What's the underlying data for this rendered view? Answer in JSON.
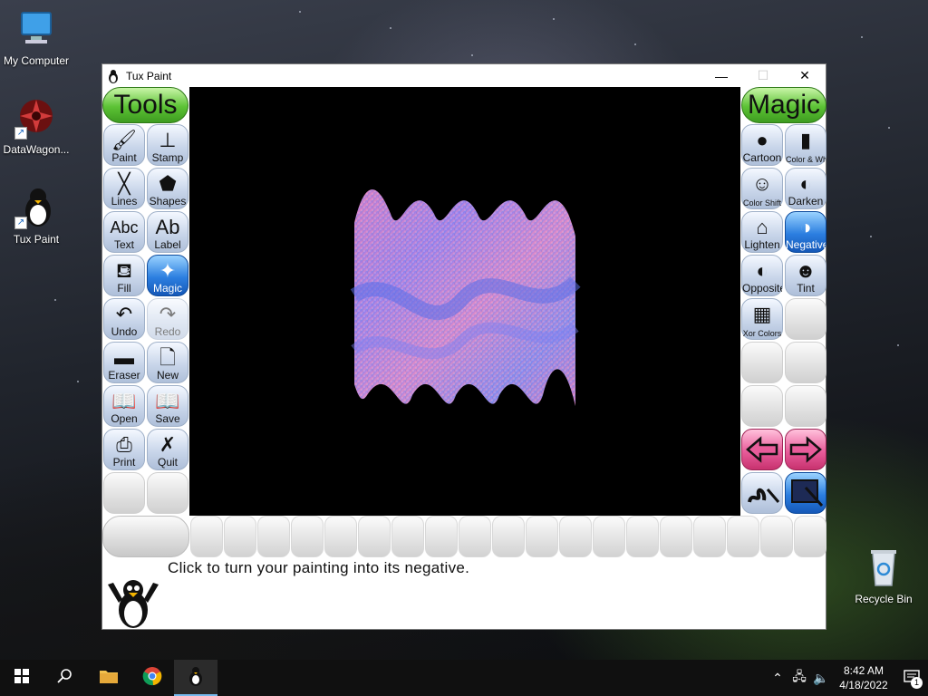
{
  "desktop": {
    "icons": [
      {
        "label": "My Computer"
      },
      {
        "label": "DataWagon..."
      },
      {
        "label": "Tux Paint"
      },
      {
        "label": "Recycle Bin"
      }
    ]
  },
  "window": {
    "title": "Tux Paint",
    "controls": {
      "minimize": "—",
      "maximize": "☐",
      "close": "✕"
    }
  },
  "tools_header": "Tools",
  "magic_header": "Magic",
  "tools": [
    {
      "label": "Paint",
      "icon": "paintbrush-icon",
      "glyph": "🖌"
    },
    {
      "label": "Stamp",
      "icon": "stamp-icon",
      "glyph": "⊥"
    },
    {
      "label": "Lines",
      "icon": "lines-icon",
      "glyph": "╳"
    },
    {
      "label": "Shapes",
      "icon": "pentagon-icon",
      "glyph": "⬟"
    },
    {
      "label": "Text",
      "icon": "text-icon",
      "glyph": "Abc"
    },
    {
      "label": "Label",
      "icon": "label-icon",
      "glyph": "Ab"
    },
    {
      "label": "Fill",
      "icon": "paint-bucket-icon",
      "glyph": "⛾"
    },
    {
      "label": "Magic",
      "icon": "magic-wand-icon",
      "glyph": "✦"
    },
    {
      "label": "Undo",
      "icon": "undo-hand-icon",
      "glyph": "↶"
    },
    {
      "label": "Redo",
      "icon": "redo-hand-icon",
      "glyph": "↷"
    },
    {
      "label": "Eraser",
      "icon": "eraser-icon",
      "glyph": "▬"
    },
    {
      "label": "New",
      "icon": "new-page-icon",
      "glyph": "🗋"
    },
    {
      "label": "Open",
      "icon": "open-book-icon",
      "glyph": "📖"
    },
    {
      "label": "Save",
      "icon": "save-book-icon",
      "glyph": "📖"
    },
    {
      "label": "Print",
      "icon": "printer-icon",
      "glyph": "⎙"
    },
    {
      "label": "Quit",
      "icon": "quit-x-icon",
      "glyph": "✗"
    }
  ],
  "magic_tools": [
    {
      "label": "Cartoon",
      "icon": "cartoon-icon",
      "glyph": "●"
    },
    {
      "label": "Color & White",
      "icon": "color-white-icon",
      "glyph": "▮"
    },
    {
      "label": "Color Shift",
      "icon": "color-shift-icon",
      "glyph": "☺"
    },
    {
      "label": "Darken",
      "icon": "darken-icon",
      "glyph": "◐"
    },
    {
      "label": "Lighten",
      "icon": "lighten-house-icon",
      "glyph": "⌂"
    },
    {
      "label": "Negative",
      "icon": "negative-icon",
      "glyph": "◑"
    },
    {
      "label": "Opposite",
      "icon": "opposite-icon",
      "glyph": "◐"
    },
    {
      "label": "Tint",
      "icon": "tint-faces-icon",
      "glyph": "☻"
    },
    {
      "label": "Xor Colors",
      "icon": "xor-checker-icon",
      "glyph": "▦"
    }
  ],
  "status_message": "Click to turn your painting into its negative.",
  "taskbar": {
    "time": "8:42 AM",
    "date": "4/18/2022",
    "notification_count": "1"
  },
  "colors": {
    "active_tool": "#2c7fe0",
    "header_green": "#5cc235",
    "nav_pink": "#e85c9a"
  }
}
